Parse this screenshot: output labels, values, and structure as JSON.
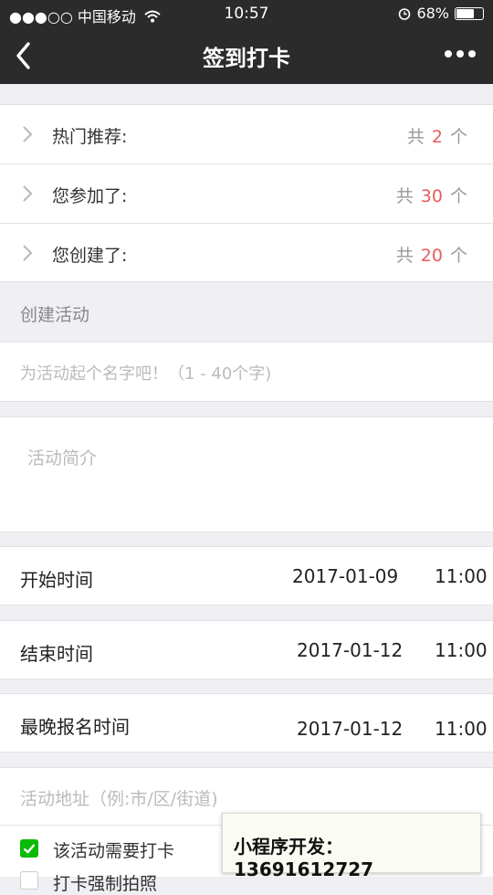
{
  "status_bar": {
    "signal": "●●●○○",
    "carrier": "中国移动",
    "wifi_icon": "wifi-icon",
    "time": "10:57",
    "alarm_icon": "alarm-icon",
    "battery_percent": "68%",
    "battery_level": 0.68
  },
  "nav": {
    "title": "签到打卡",
    "back_icon": "chevron-left-icon",
    "more_icon": "more-icon"
  },
  "summary": {
    "total_prefix": "共",
    "unit": "个",
    "items": [
      {
        "label": "热门推荐:",
        "count": "2"
      },
      {
        "label": "您参加了:",
        "count": "30"
      },
      {
        "label": "您创建了:",
        "count": "20"
      }
    ]
  },
  "create": {
    "section_title": "创建活动",
    "name_placeholder": "为活动起个名字吧！（1 - 40个字)",
    "intro_placeholder": "活动简介"
  },
  "times": [
    {
      "label": "开始时间",
      "date": "2017-01-09",
      "time": "11:00"
    },
    {
      "label": "结束时间",
      "date": "2017-01-12",
      "time": "11:00"
    },
    {
      "label": "最晚报名时间",
      "date": "2017-01-12",
      "time": "11:00"
    }
  ],
  "address_placeholder": "活动地址（例:市/区/街道)",
  "options": {
    "need_checkin": {
      "label": "该活动需要打卡",
      "checked": true
    },
    "partial_label": "打卡强制拍照"
  },
  "toast": {
    "text": "小程序开发：13691612727"
  },
  "colors": {
    "accent_red": "#e85d5d",
    "check_green": "#09bb07",
    "nav_bg": "#2b2b2b"
  }
}
